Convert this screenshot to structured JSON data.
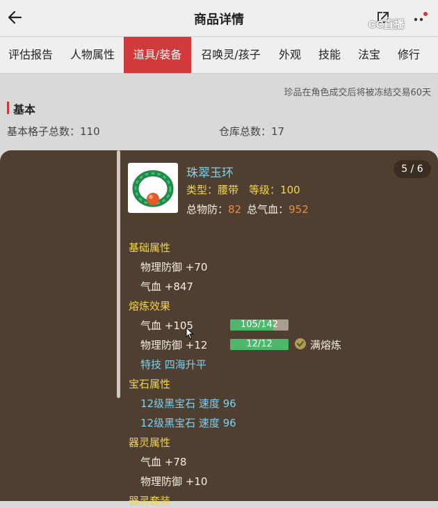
{
  "header": {
    "title": "商品详情",
    "back_icon": "arrow-left-icon",
    "share_icon": "share-icon",
    "more_icon": "more-icon",
    "watermark": "CC直播"
  },
  "tabs": [
    {
      "label": "评估报告"
    },
    {
      "label": "人物属性"
    },
    {
      "label": "道具/装备",
      "active": true
    },
    {
      "label": "召唤灵/孩子"
    },
    {
      "label": "外观"
    },
    {
      "label": "技能"
    },
    {
      "label": "法宝"
    },
    {
      "label": "修行"
    }
  ],
  "notice": "珍品在角色成交后将被冻结交易60天",
  "basic": {
    "title": "基本",
    "slots_label": "基本格子总数：",
    "slots_value": "110",
    "storage_label": "仓库总数：",
    "storage_value": "17"
  },
  "item": {
    "page_badge": "5 / 6",
    "name": "珠翠玉环",
    "type_label": "类型：",
    "type_value": "腰带",
    "level_label": "等级：",
    "level_value": "100",
    "defense_label": "总物防：",
    "defense_value": "82",
    "hp_label": "总气血：",
    "hp_value": "952",
    "sections": {
      "base_title": "基础属性",
      "base_1": "物理防御 +70",
      "base_2": "气血 +847",
      "refine_title": "熔炼效果",
      "refine_1": "气血 +105",
      "refine_1_progress": "105/142",
      "refine_1_fraction": 0.74,
      "refine_2": "物理防御 +12",
      "refine_2_progress": "12/12",
      "refine_2_fraction": 1.0,
      "full_refine": "满熔炼",
      "special": "特技 四海升平",
      "gem_title": "宝石属性",
      "gem_1": "12级黑宝石 速度 96",
      "gem_2": "12级黑宝石 速度 96",
      "spirit_title": "器灵属性",
      "spirit_1": "气血 +78",
      "spirit_2": "物理防御 +10",
      "spirit_set_title": "器灵套装"
    }
  },
  "colors": {
    "accent": "#d03a3a",
    "panel": "#4f3f30",
    "yellow": "#f2d44a",
    "cyan": "#7fd0f0",
    "orange": "#f08a3a",
    "green": "#4cb86a"
  }
}
